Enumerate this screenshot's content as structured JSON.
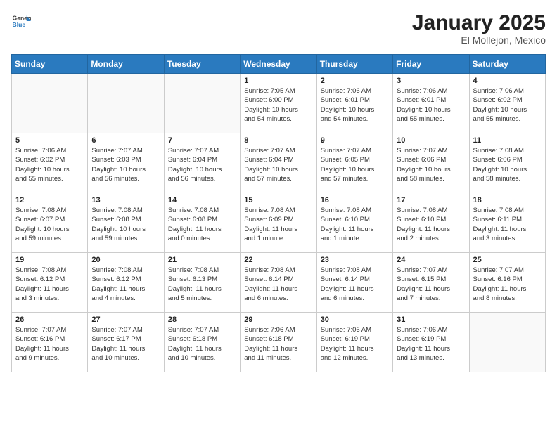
{
  "header": {
    "logo_line1": "General",
    "logo_line2": "Blue",
    "month": "January 2025",
    "location": "El Mollejon, Mexico"
  },
  "weekdays": [
    "Sunday",
    "Monday",
    "Tuesday",
    "Wednesday",
    "Thursday",
    "Friday",
    "Saturday"
  ],
  "weeks": [
    [
      {
        "day": "",
        "info": ""
      },
      {
        "day": "",
        "info": ""
      },
      {
        "day": "",
        "info": ""
      },
      {
        "day": "1",
        "info": "Sunrise: 7:05 AM\nSunset: 6:00 PM\nDaylight: 10 hours\nand 54 minutes."
      },
      {
        "day": "2",
        "info": "Sunrise: 7:06 AM\nSunset: 6:01 PM\nDaylight: 10 hours\nand 54 minutes."
      },
      {
        "day": "3",
        "info": "Sunrise: 7:06 AM\nSunset: 6:01 PM\nDaylight: 10 hours\nand 55 minutes."
      },
      {
        "day": "4",
        "info": "Sunrise: 7:06 AM\nSunset: 6:02 PM\nDaylight: 10 hours\nand 55 minutes."
      }
    ],
    [
      {
        "day": "5",
        "info": "Sunrise: 7:06 AM\nSunset: 6:02 PM\nDaylight: 10 hours\nand 55 minutes."
      },
      {
        "day": "6",
        "info": "Sunrise: 7:07 AM\nSunset: 6:03 PM\nDaylight: 10 hours\nand 56 minutes."
      },
      {
        "day": "7",
        "info": "Sunrise: 7:07 AM\nSunset: 6:04 PM\nDaylight: 10 hours\nand 56 minutes."
      },
      {
        "day": "8",
        "info": "Sunrise: 7:07 AM\nSunset: 6:04 PM\nDaylight: 10 hours\nand 57 minutes."
      },
      {
        "day": "9",
        "info": "Sunrise: 7:07 AM\nSunset: 6:05 PM\nDaylight: 10 hours\nand 57 minutes."
      },
      {
        "day": "10",
        "info": "Sunrise: 7:07 AM\nSunset: 6:06 PM\nDaylight: 10 hours\nand 58 minutes."
      },
      {
        "day": "11",
        "info": "Sunrise: 7:08 AM\nSunset: 6:06 PM\nDaylight: 10 hours\nand 58 minutes."
      }
    ],
    [
      {
        "day": "12",
        "info": "Sunrise: 7:08 AM\nSunset: 6:07 PM\nDaylight: 10 hours\nand 59 minutes."
      },
      {
        "day": "13",
        "info": "Sunrise: 7:08 AM\nSunset: 6:08 PM\nDaylight: 10 hours\nand 59 minutes."
      },
      {
        "day": "14",
        "info": "Sunrise: 7:08 AM\nSunset: 6:08 PM\nDaylight: 11 hours\nand 0 minutes."
      },
      {
        "day": "15",
        "info": "Sunrise: 7:08 AM\nSunset: 6:09 PM\nDaylight: 11 hours\nand 1 minute."
      },
      {
        "day": "16",
        "info": "Sunrise: 7:08 AM\nSunset: 6:10 PM\nDaylight: 11 hours\nand 1 minute."
      },
      {
        "day": "17",
        "info": "Sunrise: 7:08 AM\nSunset: 6:10 PM\nDaylight: 11 hours\nand 2 minutes."
      },
      {
        "day": "18",
        "info": "Sunrise: 7:08 AM\nSunset: 6:11 PM\nDaylight: 11 hours\nand 3 minutes."
      }
    ],
    [
      {
        "day": "19",
        "info": "Sunrise: 7:08 AM\nSunset: 6:12 PM\nDaylight: 11 hours\nand 3 minutes."
      },
      {
        "day": "20",
        "info": "Sunrise: 7:08 AM\nSunset: 6:12 PM\nDaylight: 11 hours\nand 4 minutes."
      },
      {
        "day": "21",
        "info": "Sunrise: 7:08 AM\nSunset: 6:13 PM\nDaylight: 11 hours\nand 5 minutes."
      },
      {
        "day": "22",
        "info": "Sunrise: 7:08 AM\nSunset: 6:14 PM\nDaylight: 11 hours\nand 6 minutes."
      },
      {
        "day": "23",
        "info": "Sunrise: 7:08 AM\nSunset: 6:14 PM\nDaylight: 11 hours\nand 6 minutes."
      },
      {
        "day": "24",
        "info": "Sunrise: 7:07 AM\nSunset: 6:15 PM\nDaylight: 11 hours\nand 7 minutes."
      },
      {
        "day": "25",
        "info": "Sunrise: 7:07 AM\nSunset: 6:16 PM\nDaylight: 11 hours\nand 8 minutes."
      }
    ],
    [
      {
        "day": "26",
        "info": "Sunrise: 7:07 AM\nSunset: 6:16 PM\nDaylight: 11 hours\nand 9 minutes."
      },
      {
        "day": "27",
        "info": "Sunrise: 7:07 AM\nSunset: 6:17 PM\nDaylight: 11 hours\nand 10 minutes."
      },
      {
        "day": "28",
        "info": "Sunrise: 7:07 AM\nSunset: 6:18 PM\nDaylight: 11 hours\nand 10 minutes."
      },
      {
        "day": "29",
        "info": "Sunrise: 7:06 AM\nSunset: 6:18 PM\nDaylight: 11 hours\nand 11 minutes."
      },
      {
        "day": "30",
        "info": "Sunrise: 7:06 AM\nSunset: 6:19 PM\nDaylight: 11 hours\nand 12 minutes."
      },
      {
        "day": "31",
        "info": "Sunrise: 7:06 AM\nSunset: 6:19 PM\nDaylight: 11 hours\nand 13 minutes."
      },
      {
        "day": "",
        "info": ""
      }
    ]
  ]
}
